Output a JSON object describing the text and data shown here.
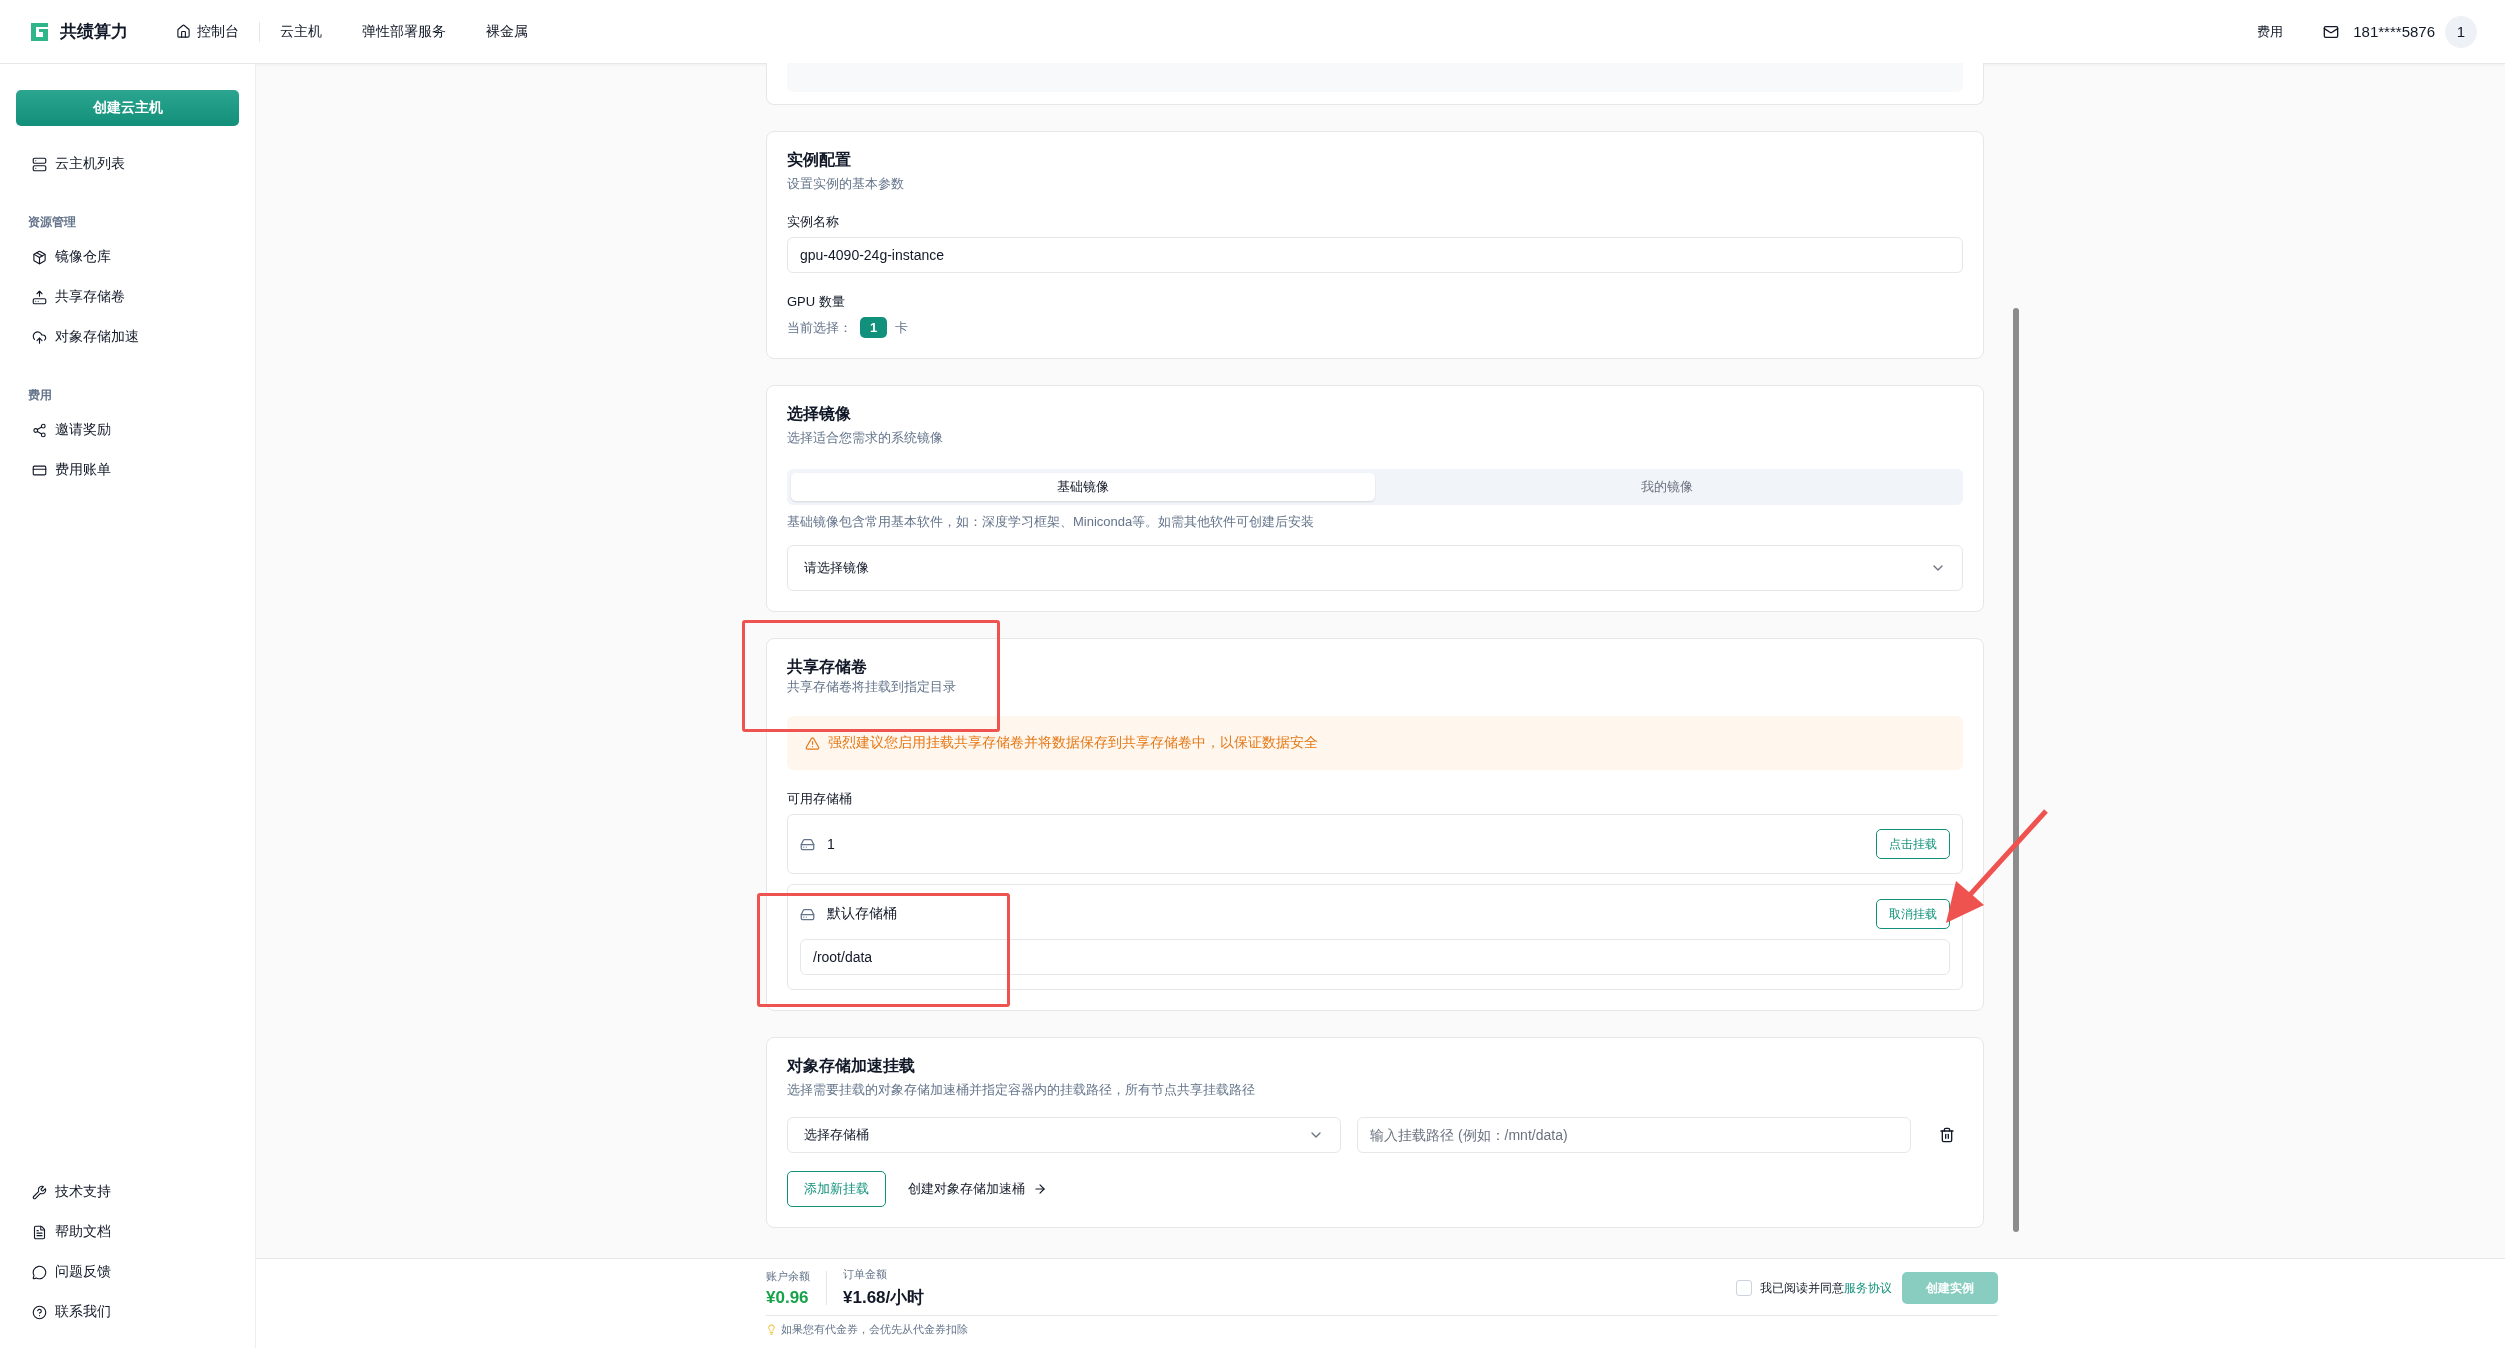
{
  "header": {
    "brand": "共绩算力",
    "nav": [
      {
        "label": "控制台"
      },
      {
        "label": "云主机"
      },
      {
        "label": "弹性部署服务"
      },
      {
        "label": "裸金属"
      }
    ],
    "fee": "费用",
    "phone": "181****5876",
    "avatar": "1"
  },
  "sidebar": {
    "create_button": "创建云主机",
    "groups": [
      {
        "items": [
          {
            "label": "云主机列表"
          }
        ]
      },
      {
        "title": "资源管理",
        "items": [
          {
            "label": "镜像仓库"
          },
          {
            "label": "共享存储卷"
          },
          {
            "label": "对象存储加速"
          }
        ]
      },
      {
        "title": "费用",
        "items": [
          {
            "label": "邀请奖励"
          },
          {
            "label": "费用账单"
          }
        ]
      }
    ],
    "bottom_items": [
      {
        "label": "技术支持"
      },
      {
        "label": "帮助文档"
      },
      {
        "label": "问题反馈"
      },
      {
        "label": "联系我们"
      }
    ]
  },
  "instance_config": {
    "title": "实例配置",
    "subtitle": "设置实例的基本参数",
    "name_label": "实例名称",
    "name_value": "gpu-4090-24g-instance",
    "gpu_label": "GPU 数量",
    "current_label": "当前选择：",
    "gpu_count": "1",
    "unit": "卡"
  },
  "image_select": {
    "title": "选择镜像",
    "subtitle": "选择适合您需求的系统镜像",
    "tabs": [
      {
        "label": "基础镜像",
        "selected": true
      },
      {
        "label": "我的镜像",
        "selected": false
      }
    ],
    "hint": "基础镜像包含常用基本软件，如：深度学习框架、Miniconda等。如需其他软件可创建后安装",
    "dropdown": "请选择镜像"
  },
  "shared_storage": {
    "title": "共享存储卷",
    "subtitle": "共享存储卷将挂载到指定目录",
    "warning": "强烈建议您启用挂载共享存储卷并将数据保存到共享存储卷中，以保证数据安全",
    "available_label": "可用存储桶",
    "buckets": [
      {
        "kind": "available",
        "name": "1",
        "action": "点击挂载"
      },
      {
        "kind": "mounted",
        "name": "默认存储桶",
        "action": "取消挂载",
        "path": "/root/data"
      }
    ]
  },
  "object_storage": {
    "title": "对象存储加速挂载",
    "subtitle": "选择需要挂载的对象存储加速桶并指定容器内的挂载路径，所有节点共享挂载路径",
    "bucket_select": "选择存储桶",
    "path_placeholder": "输入挂载路径 (例如：/mnt/data)",
    "add_button": "添加新挂载",
    "create_link": "创建对象存储加速桶"
  },
  "footer": {
    "balance_label": "账户余额",
    "balance": "¥0.96",
    "order_label": "订单金额",
    "order": "¥1.68/小时",
    "tip": "如果您有代金券，会优先从代金券扣除",
    "agree_text": "我已阅读并同意",
    "agree_link": "服务协议",
    "agreed": false,
    "submit": "创建实例",
    "submit_disabled": true
  },
  "annotations": [
    {
      "kind": "box"
    },
    {
      "kind": "box"
    },
    {
      "kind": "arrow"
    }
  ]
}
